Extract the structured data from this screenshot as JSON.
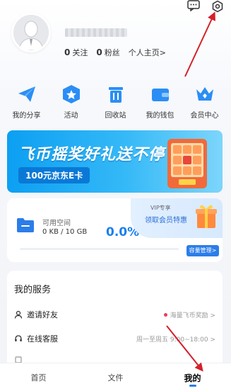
{
  "icons": {
    "message": "message-icon",
    "settings": "gear-icon"
  },
  "profile": {
    "follow_count": "0",
    "follow_label": "关注",
    "fans_count": "0",
    "fans_label": "粉丝",
    "home_link": "个人主页>"
  },
  "quick_actions": [
    {
      "label": "我的分享",
      "icon": "share-icon"
    },
    {
      "label": "活动",
      "icon": "star-icon"
    },
    {
      "label": "回收站",
      "icon": "trash-icon"
    },
    {
      "label": "我的钱包",
      "icon": "wallet-icon"
    },
    {
      "label": "会员中心",
      "icon": "crown-icon"
    }
  ],
  "banner": {
    "title": "飞币摇奖好礼送不停",
    "subtitle": "100元京东E卡"
  },
  "storage": {
    "label": "可用空间",
    "value": "0 KB / 10 GB",
    "percent": "0.0%",
    "progress": 0.0,
    "manage_label": "容量管理>",
    "vip_tag": "VIP专享",
    "vip_text": "领取会员特惠"
  },
  "services": {
    "title": "我的服务",
    "items": [
      {
        "label": "邀请好友",
        "right": "海量飞币奖励 >",
        "has_dot": true
      },
      {
        "label": "在线客服",
        "right": "周一至周五 9:00~18:00 >",
        "has_dot": false
      }
    ]
  },
  "tabbar": {
    "tabs": [
      "首页",
      "文件",
      "我的"
    ],
    "active": 2
  },
  "colors": {
    "accent": "#1a7ff0",
    "annotation": "#d4202a"
  }
}
